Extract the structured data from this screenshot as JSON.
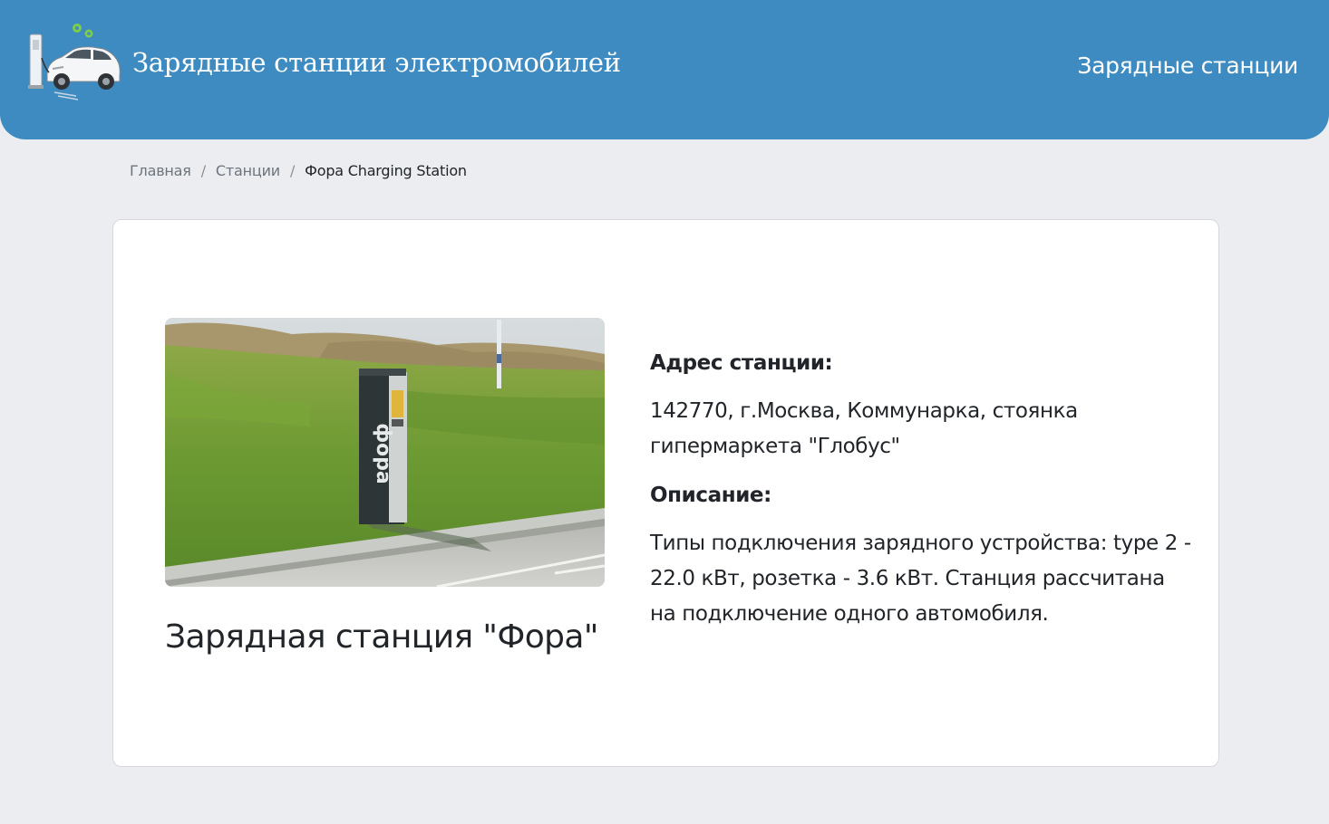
{
  "header": {
    "brand_title": "Зарядные станции электромобилей",
    "nav_link": "Зарядные станции",
    "background_color": "#3e8bc1"
  },
  "breadcrumb": {
    "items": [
      "Главная",
      "Станции"
    ],
    "separator": "/",
    "current": "Фора Charging Station"
  },
  "station": {
    "title": "Зарядная станция \"Фора\"",
    "address_label": "Адрес станции:",
    "address": "142770, г.Москва, Коммунарка, стоянка гипермаркета \"Глобус\"",
    "description_label": "Описание:",
    "description": "Типы подключения зарядного устройства: type 2 - 22.0 кВт, розетка - 3.6 кВт. Станция рассчитана на подключение одного автомобиля.",
    "photo_lettering": "фора"
  }
}
